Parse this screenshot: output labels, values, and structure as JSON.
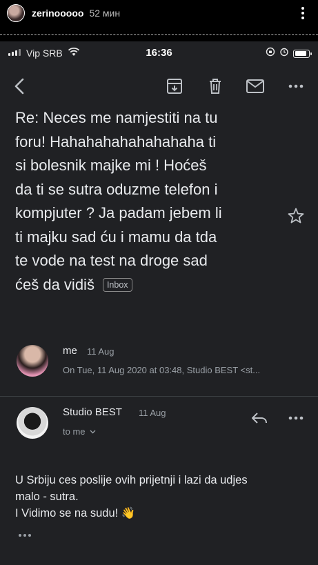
{
  "story": {
    "username": "zerinooooo",
    "time_ago": "52 мин"
  },
  "status_bar": {
    "carrier": "Vip SRB",
    "time": "16:36",
    "battery_level": 0.85
  },
  "toolbar": {
    "icons": [
      "back-arrow-icon",
      "archive-icon",
      "delete-icon",
      "mark-unread-icon",
      "more-options-icon"
    ]
  },
  "email": {
    "subject_lines": [
      "Re: Neces me namjestiti na tu",
      "foru! Hahahahahahahahaha ti",
      "si bolesnik majke mi ! Hoćeš",
      "da ti se sutra oduzme telefon i",
      "kompjuter ? Ja padam jebem li",
      "ti majku sad ću i mamu da tda",
      "te vode na test na droge sad",
      "ćeš da vidiš"
    ],
    "label": "Inbox",
    "thread": [
      {
        "sender": "me",
        "date": "11 Aug",
        "snippet": "On Tue, 11 Aug 2020 at 03:48, Studio BEST <st..."
      },
      {
        "sender": "Studio BEST",
        "date": "11 Aug",
        "recipient": "to me",
        "body_lines": [
          "U Srbiju ces poslije ovih prijetnji i lazi da udjes",
          "malo - sutra.",
          "I Vidimo se na sudu! 👋"
        ]
      }
    ]
  },
  "colors": {
    "background": "#202124",
    "text_primary": "#e8eaed",
    "text_secondary": "#9aa0a6",
    "icon": "#bdc1c6"
  }
}
